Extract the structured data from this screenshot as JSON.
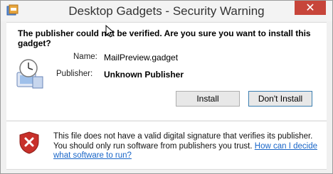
{
  "window": {
    "title": "Desktop Gadgets - Security Warning",
    "close_label": "✕"
  },
  "prompt": {
    "question": "The publisher could not be verified. Are you sure you want to install this gadget?",
    "name_label": "Name:",
    "name_value": "MailPreview.gadget",
    "publisher_label": "Publisher:",
    "publisher_value": "Unknown Publisher"
  },
  "buttons": {
    "install": "Install",
    "dont_install": "Don't Install"
  },
  "warning": {
    "text": "This file does not have a valid digital signature that verifies its publisher. You should only run software from publishers you trust.",
    "link": "How can I decide what software to run?"
  },
  "colors": {
    "close_red": "#c7453a",
    "link_blue": "#1a66c8"
  }
}
